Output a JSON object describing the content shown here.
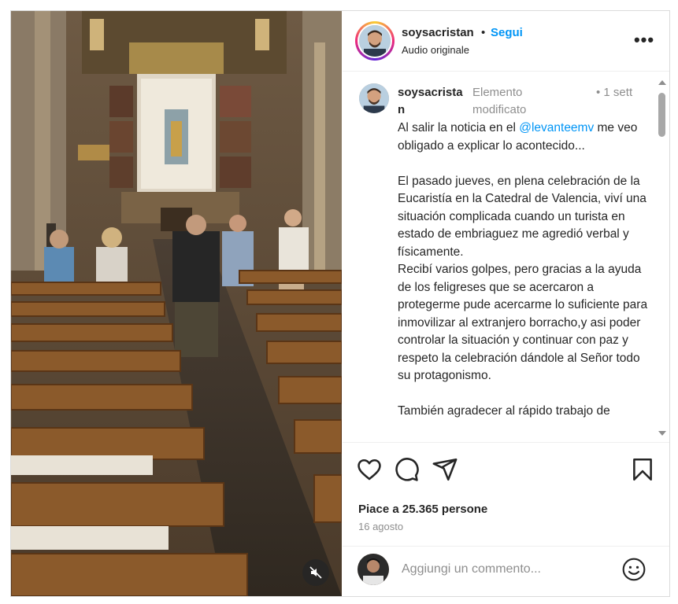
{
  "post": {
    "username": "soysacristan",
    "separator": "•",
    "follow_label": "Segui",
    "audio_label": "Audio originale",
    "more_icon": "more-options-icon",
    "more_label": "•••"
  },
  "caption": {
    "username": "soysacristan",
    "edited_label": "Elemento modificato",
    "time_label": "• 1 sett",
    "text_before_mention": "Al salir la noticia en el ",
    "mention": "@levanteemv",
    "text_after_mention": " me veo obligado a explicar lo acontecido...\n\nEl pasado jueves, en plena celebración de la Eucaristía en la Catedral de Valencia, viví una situación complicada cuando un turista en estado de embriaguez me agredió verbal y físicamente.\nRecibí varios golpes, pero gracias a la ayuda de los feligreses que se acercaron a protegerme pude acercarme lo suficiente para inmovilizar al extranjero borracho,y asi poder controlar la situación y continuar con paz y respeto la celebración dándole al Señor todo su protagonismo.\n\nTambién agradecer al rápido trabajo de"
  },
  "actions": {
    "icons": [
      "heart-icon",
      "comment-icon",
      "share-icon",
      "bookmark-icon"
    ],
    "likes_label": "Piace a 25.365 persone",
    "date_label": "16 agosto"
  },
  "comment": {
    "placeholder": "Aggiungi un commento...",
    "emoji_icon": "emoji-icon"
  },
  "media": {
    "mute_icon": "muted-speaker-icon"
  },
  "colors": {
    "accent": "#0095f6",
    "text": "#262626",
    "secondary_text": "#8e8e8e",
    "border": "#dbdbdb"
  }
}
